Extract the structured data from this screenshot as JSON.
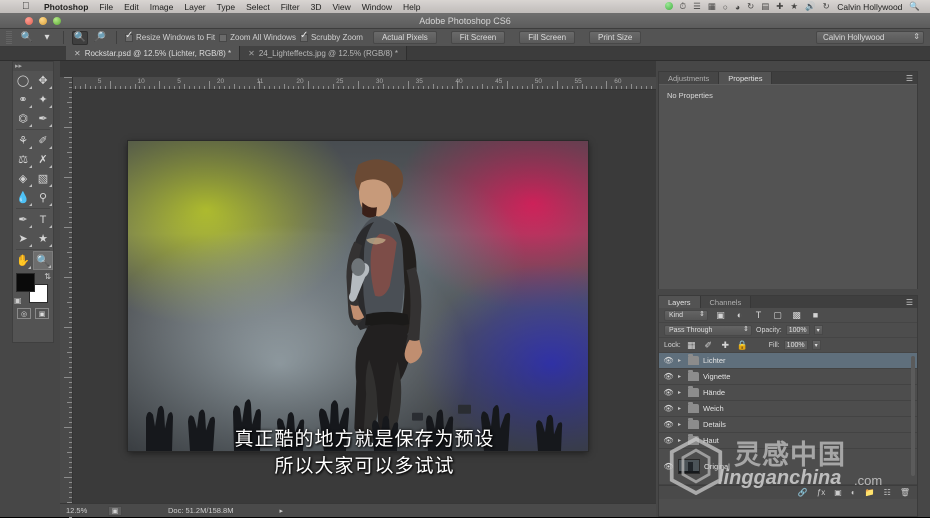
{
  "macmenu": {
    "apple_icon": "apple-icon",
    "items": [
      "Photoshop",
      "File",
      "Edit",
      "Image",
      "Layer",
      "Type",
      "Select",
      "Filter",
      "3D",
      "View",
      "Window",
      "Help"
    ],
    "status_icons": [
      "dropbox-icon",
      "timemachine-icon",
      "text-icon",
      "keyboard-icon",
      "bluetooth-icon",
      "wifi-icon",
      "clock-icon",
      "display-icon",
      "network-icon",
      "user-switch-icon",
      "volume-icon",
      "sync-icon"
    ],
    "user": "Calvin Hollywood",
    "search_icon": "search-icon"
  },
  "window": {
    "title": "Adobe Photoshop CS6",
    "close_label": "close",
    "minimize_label": "minimize",
    "zoom_label": "zoom"
  },
  "options_bar": {
    "tool_icon": "zoom-tool-icon",
    "preset_caret": "chevron-down-icon",
    "zoom_in_icon": "zoom-in-icon",
    "zoom_out_icon": "zoom-out-icon",
    "checkboxes": [
      {
        "label": "Resize Windows to Fit",
        "checked": true
      },
      {
        "label": "Zoom All Windows",
        "checked": false
      },
      {
        "label": "Scrubby Zoom",
        "checked": true
      }
    ],
    "buttons": [
      "Actual Pixels",
      "Fit Screen",
      "Fill Screen",
      "Print Size"
    ],
    "workspace": "Calvin Hollywood"
  },
  "tabs": [
    {
      "label": "Rockstar.psd @ 12.5% (Lichter, RGB/8) *",
      "active": true
    },
    {
      "label": "24_Lighteffects.jpg @ 12.5% (RGB/8) *",
      "active": false
    }
  ],
  "toolbar": {
    "tools": [
      "marquee-elliptical-icon",
      "move-icon",
      "lasso-icon",
      "quick-selection-icon",
      "crop-icon",
      "eyedropper-icon",
      "healing-brush-icon",
      "brush-icon",
      "clone-stamp-icon",
      "history-brush-icon",
      "eraser-icon",
      "gradient-icon",
      "blur-icon",
      "dodge-icon",
      "pen-icon",
      "type-icon",
      "path-selection-icon",
      "shape-icon",
      "hand-icon",
      "zoom-icon"
    ],
    "selected_tool": "zoom-icon",
    "foreground_color": "#0a0a0a",
    "background_color": "#ffffff",
    "quickmask_icon": "quick-mask-icon",
    "screenmode_icon": "screen-mode-icon"
  },
  "ruler": {
    "labels": [
      "5",
      "10",
      "5",
      "20",
      "11",
      "20",
      "25",
      "30",
      "35",
      "40",
      "45",
      "50",
      "55",
      "60"
    ],
    "unit": "cm"
  },
  "canvas": {
    "document_name": "Rockstar.psd",
    "image_description": "rock singer on stage with colored lights and raised hands"
  },
  "subtitles": {
    "line1": "真正酷的地方就是保存为预设",
    "line2": "所以大家可以多试试"
  },
  "status_bar": {
    "zoom": "12.5%",
    "proxy_icon": "proxy-icon",
    "doc_info": "Doc: 51.2M/158.8M",
    "arrow_icon": "chevron-right-icon"
  },
  "properties_panel": {
    "tabs": [
      {
        "label": "Adjustments",
        "active": false
      },
      {
        "label": "Properties",
        "active": true
      }
    ],
    "menu_icon": "panel-menu-icon",
    "empty_message": "No Properties"
  },
  "layers_panel": {
    "tabs": [
      {
        "label": "Layers",
        "active": true
      },
      {
        "label": "Channels",
        "active": false
      }
    ],
    "menu_icon": "panel-menu-icon",
    "filter_kind": "Kind",
    "filter_icons": [
      "filter-pixel-icon",
      "filter-adjustment-icon",
      "filter-type-icon",
      "filter-shape-icon",
      "filter-smart-icon",
      "filter-toggle-icon"
    ],
    "blend_mode": "Pass Through",
    "opacity_label": "Opacity:",
    "opacity_value": "100%",
    "lock_label": "Lock:",
    "lock_icons": [
      "lock-transparent-icon",
      "lock-image-icon",
      "lock-position-icon",
      "lock-all-icon"
    ],
    "fill_label": "Fill:",
    "fill_value": "100%",
    "layers": [
      {
        "name": "Lichter",
        "type": "group",
        "visible": true,
        "selected": true
      },
      {
        "name": "Vignette",
        "type": "group",
        "visible": true,
        "selected": false
      },
      {
        "name": "Hände",
        "type": "group",
        "visible": true,
        "selected": false
      },
      {
        "name": "Weich",
        "type": "group",
        "visible": true,
        "selected": false
      },
      {
        "name": "Details",
        "type": "group",
        "visible": true,
        "selected": false
      },
      {
        "name": "Haut",
        "type": "group",
        "visible": true,
        "selected": false
      },
      {
        "name": "Original",
        "type": "image",
        "visible": true,
        "selected": false
      }
    ],
    "footer_icons": [
      "link-icon",
      "fx-icon",
      "mask-icon",
      "adjustment-icon",
      "group-icon",
      "new-layer-icon",
      "delete-icon"
    ]
  },
  "watermark": {
    "logo_icon": "lingganchina-logo-icon",
    "cn_text": "灵感中国",
    "site_name": "lingganchina",
    "site_tld": ".com"
  }
}
